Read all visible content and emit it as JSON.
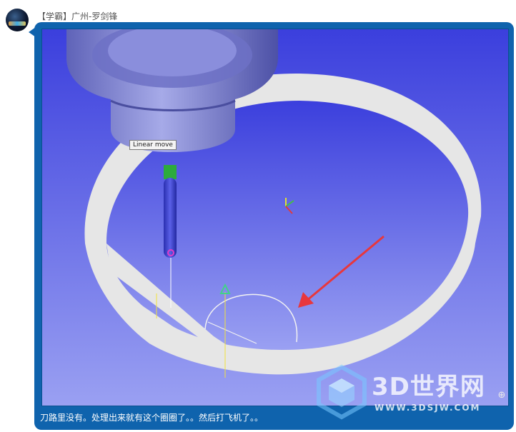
{
  "post": {
    "username": "【学霸】广州-罗剑锋",
    "message": "刀路里没有。处理出来就有这个圈圈了。。然后打飞机了。。"
  },
  "viewport": {
    "tooltip": "Linear move",
    "background_top": "#3b3fdd",
    "background_bottom": "#9aa0f2",
    "stock_color": "#e6e6e6",
    "tool_color": "#7b7fd6",
    "annotation_arrow_color": "#e8373c"
  },
  "watermark": {
    "title": "3D世界网",
    "url": "WWW.3DSJW.COM"
  },
  "icons": {
    "expand": "expand-icon"
  }
}
